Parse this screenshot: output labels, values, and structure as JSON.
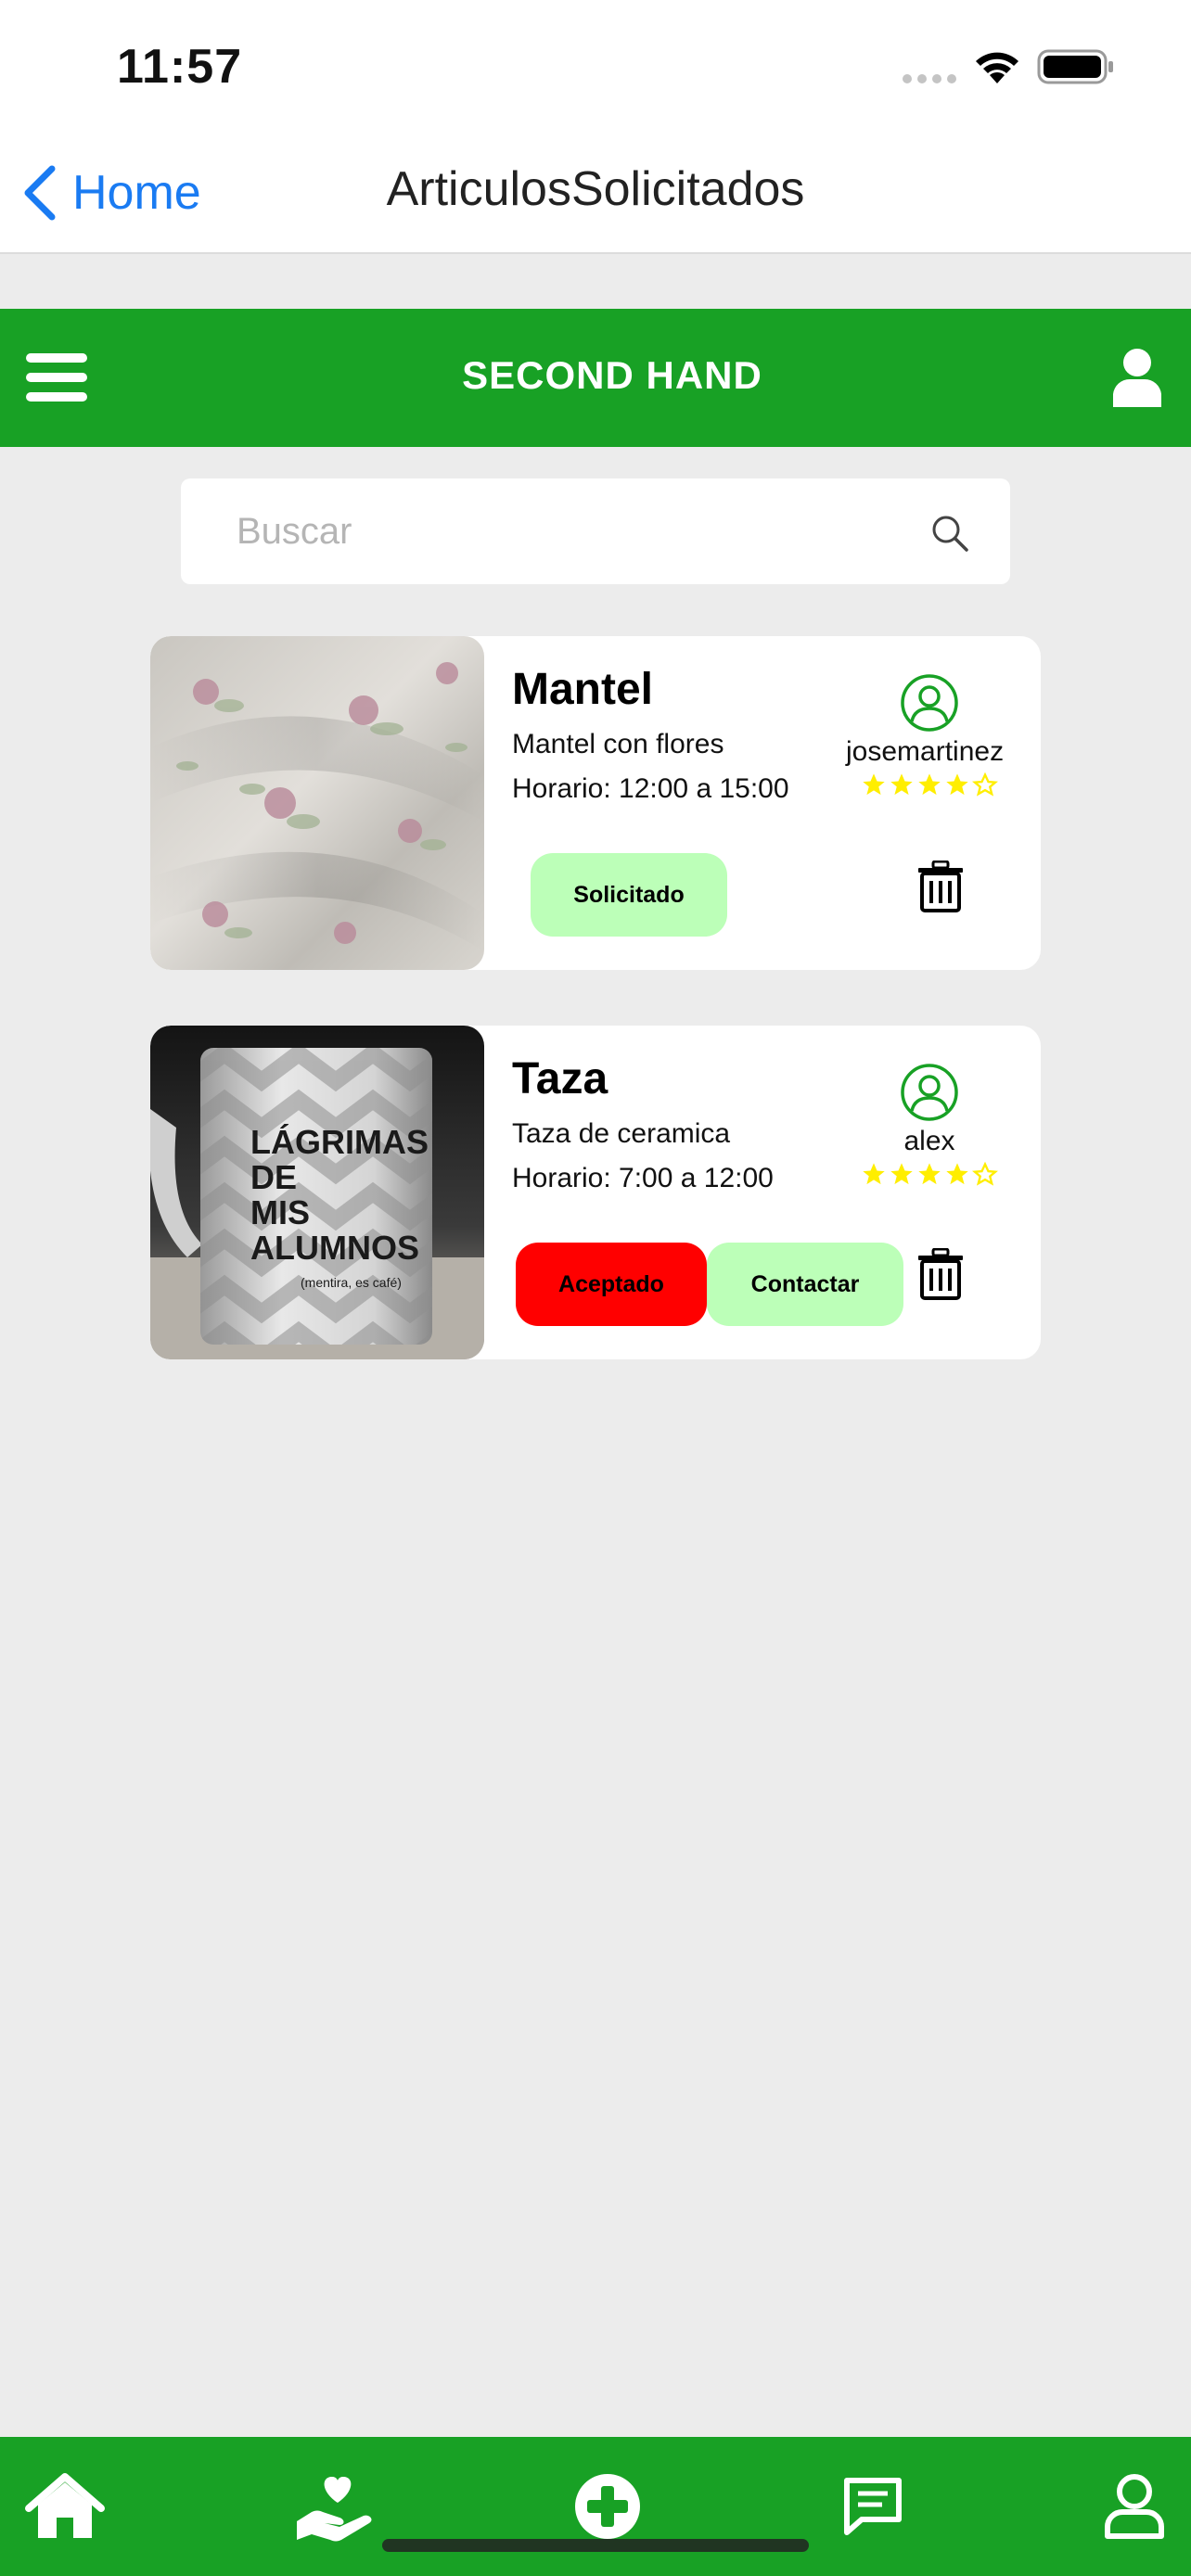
{
  "status_bar": {
    "time": "11:57"
  },
  "nav": {
    "back_label": "Home",
    "title": "ArticulosSolicitados"
  },
  "header": {
    "title": "SECOND HAND"
  },
  "search": {
    "placeholder": "Buscar"
  },
  "colors": {
    "brand_green": "#18a125",
    "light_green": "#bcffb8",
    "red": "#ff0000",
    "star_yellow": "#ffee00",
    "ios_blue": "#1a7bf2"
  },
  "items": [
    {
      "title": "Mantel",
      "description": "Mantel con flores",
      "hours": "Horario: 12:00 a 15:00",
      "user": "josemartinez",
      "rating": 4,
      "rating_max": 5,
      "buttons": [
        {
          "label": "Solicitado",
          "style": "green"
        }
      ]
    },
    {
      "title": "Taza",
      "description": "Taza de ceramica",
      "hours": "Horario: 7:00 a 12:00",
      "user": "alex",
      "rating": 4,
      "rating_max": 5,
      "buttons": [
        {
          "label": "Aceptado",
          "style": "red"
        },
        {
          "label": "Contactar",
          "style": "green"
        }
      ],
      "mug_text": [
        "LÁGRIMAS",
        "DE",
        "MIS",
        "ALUMNOS",
        "(mentira, es café)"
      ]
    }
  ],
  "tabs": [
    {
      "name": "home",
      "icon": "home-icon"
    },
    {
      "name": "donate",
      "icon": "hand-heart-icon"
    },
    {
      "name": "add",
      "icon": "plus-circle-icon"
    },
    {
      "name": "messages",
      "icon": "chat-icon"
    },
    {
      "name": "profile",
      "icon": "person-icon"
    }
  ]
}
